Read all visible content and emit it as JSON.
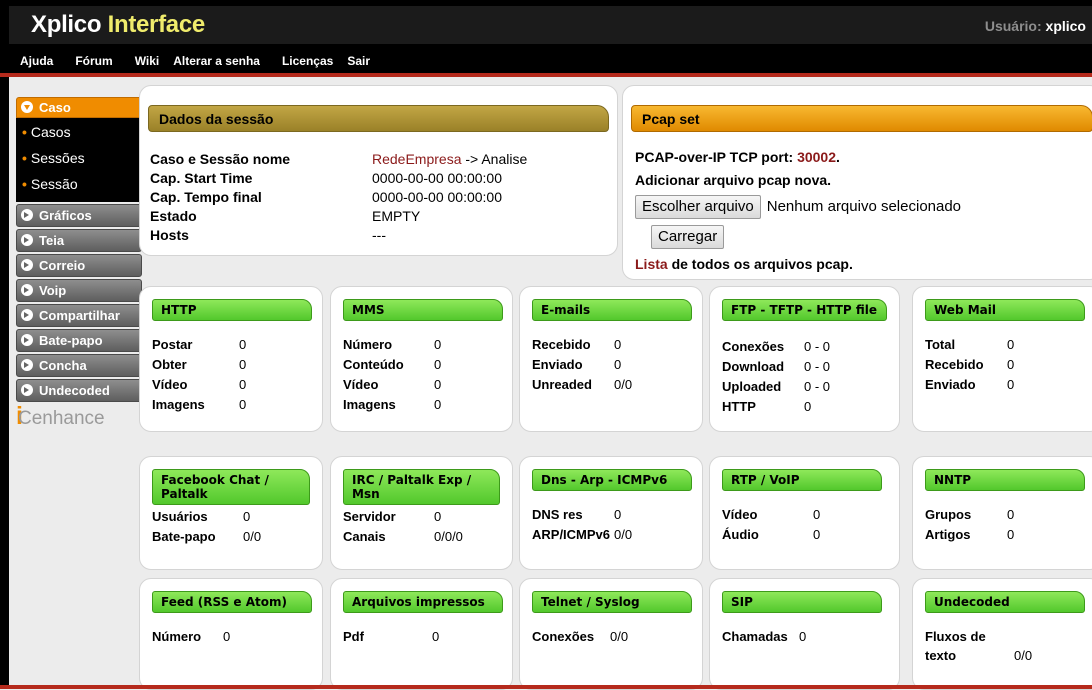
{
  "header": {
    "title_part1": "Xplico",
    "title_part2": "Interface",
    "user_label": "Usuário:",
    "user_name": "xplico"
  },
  "menu": [
    "Ajuda",
    "Fórum",
    "Wiki",
    "Alterar a senha",
    "Licenças",
    "Sair"
  ],
  "sidebar": {
    "open_section": "Caso",
    "sub_items": [
      "Casos",
      "Sessões",
      "Sessão"
    ],
    "items": [
      "Gráficos",
      "Teia",
      "Correio",
      "Voip",
      "Compartilhar",
      "Bate-papo",
      "Concha",
      "Undecoded"
    ],
    "logo_mark": "i",
    "logo_text": "Cenhance"
  },
  "session": {
    "title": "Dados da sessão",
    "rows": [
      {
        "label": "Caso e Sessão nome",
        "value_link": "RedeEmpresa",
        "value": " -> Analise"
      },
      {
        "label": "Cap. Start Time",
        "value_link": "",
        "value": "0000-00-00 00:00:00"
      },
      {
        "label": "Cap. Tempo final",
        "value_link": "",
        "value": "0000-00-00 00:00:00"
      },
      {
        "label": "Estado",
        "value_link": "",
        "value": "EMPTY"
      },
      {
        "label": "Hosts",
        "value_link": "",
        "value": "---"
      }
    ]
  },
  "pcap": {
    "title": "Pcap set",
    "port_text": "PCAP-over-IP TCP port: ",
    "port": "30002",
    "port_suffix": ".",
    "add_text": "Adicionar arquivo pcap nova.",
    "choose_button": "Escolher arquivo",
    "no_file": "Nenhum arquivo selecionado",
    "upload_button": "Carregar",
    "list_link": "Lista",
    "list_text": " de todos os arquivos pcap."
  },
  "cards": [
    {
      "title": "HTTP",
      "rows": [
        [
          "Postar",
          "0"
        ],
        [
          "Obter",
          "0"
        ],
        [
          "Vídeo",
          "0"
        ],
        [
          "Imagens",
          "0"
        ]
      ]
    },
    {
      "title": "MMS",
      "rows": [
        [
          "Número",
          "0"
        ],
        [
          "Conteúdo",
          "0"
        ],
        [
          "Vídeo",
          "0"
        ],
        [
          "Imagens",
          "0"
        ]
      ]
    },
    {
      "title": "E-mails",
      "rows": [
        [
          "Recebido",
          "0"
        ],
        [
          "Enviado",
          "0"
        ],
        [
          "Unreaded",
          "0/0"
        ]
      ]
    },
    {
      "title": "FTP - TFTP - HTTP file",
      "rows": [
        [
          "Conexões",
          "0 - 0"
        ],
        [
          "Download",
          "0 - 0"
        ],
        [
          "Uploaded",
          "0 - 0"
        ],
        [
          "HTTP",
          "0"
        ]
      ]
    },
    {
      "title": "Web Mail",
      "rows": [
        [
          "Total",
          "0"
        ],
        [
          "Recebido",
          "0"
        ],
        [
          "Enviado",
          "0"
        ]
      ]
    },
    {
      "title": "Facebook Chat / Paltalk",
      "rows": [
        [
          "Usuários",
          "0"
        ],
        [
          "Bate-papo",
          "0/0"
        ]
      ]
    },
    {
      "title": "IRC / Paltalk Exp / Msn",
      "rows": [
        [
          "Servidor",
          "0"
        ],
        [
          "Canais",
          "0/0/0"
        ]
      ]
    },
    {
      "title": "Dns - Arp - ICMPv6",
      "rows": [
        [
          "DNS res",
          "0"
        ],
        [
          "ARP/ICMPv6",
          "0/0"
        ]
      ]
    },
    {
      "title": "RTP / VoIP",
      "rows": [
        [
          "Vídeo",
          "0"
        ],
        [
          "Áudio",
          "0"
        ]
      ]
    },
    {
      "title": "NNTP",
      "rows": [
        [
          "Grupos",
          "0"
        ],
        [
          "Artigos",
          "0"
        ]
      ]
    },
    {
      "title": "Feed (RSS e Atom)",
      "rows": [
        [
          "Número",
          "0"
        ]
      ]
    },
    {
      "title": "Arquivos impressos",
      "rows": [
        [
          "Pdf",
          "0"
        ]
      ]
    },
    {
      "title": "Telnet / Syslog",
      "rows": [
        [
          "Conexões",
          "0/0"
        ]
      ]
    },
    {
      "title": "SIP",
      "rows": [
        [
          "Chamadas",
          "0"
        ]
      ]
    },
    {
      "title": "Undecoded",
      "rows": [
        [
          "Fluxos de texto",
          "0/0"
        ]
      ]
    }
  ]
}
